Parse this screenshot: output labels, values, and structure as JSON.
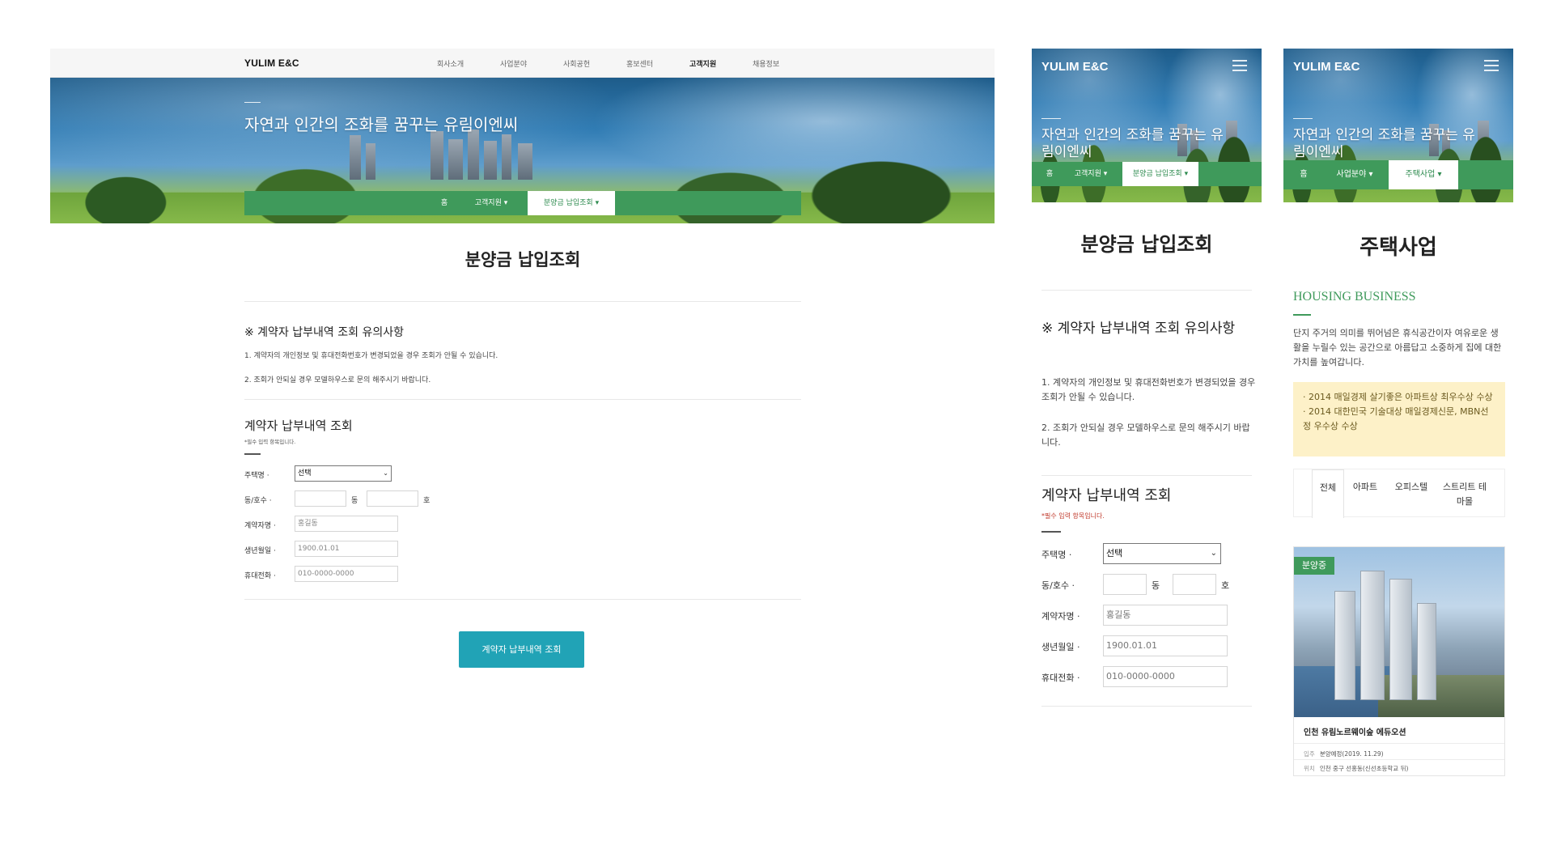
{
  "desktop": {
    "logo": "YULIM E&C",
    "menu": [
      "회사소개",
      "사업분야",
      "사회공헌",
      "홍보센터",
      "고객지원",
      "채용정보"
    ],
    "hero_title": "자연과 인간의 조화를 꿈꾸는 유림이엔씨",
    "breadcrumb": {
      "home": "홈",
      "level1": "고객지원 ▾",
      "level2": "분양금 납입조회 ▾"
    },
    "page_title": "분양금 납입조회",
    "notice": {
      "title": "※ 계약자 납부내역 조회 유의사항",
      "line1": "1. 계약자의 개인정보 및 휴대전화번호가 변경되었을 경우 조회가 안될 수 있습니다.",
      "line2": "2. 조회가 안되실 경우 모델하우스로 문의 해주시기 바랍니다."
    },
    "form": {
      "title": "계약자 납부내역 조회",
      "required_note": "*필수 입력 항목입니다.",
      "labels": {
        "housing": "주택명 ·",
        "unit": "동/호수 ·",
        "name": "계약자명 ·",
        "birth": "생년월일 ·",
        "phone": "휴대전화 ·"
      },
      "select_value": "선택",
      "dong_suffix": "동",
      "ho_suffix": "호",
      "name_placeholder": "홍길동",
      "birth_placeholder": "1900.01.01",
      "phone_placeholder": "010-0000-0000"
    },
    "submit_label": "계약자 납부내역 조회"
  },
  "mobile1": {
    "logo": "YULIM E&C",
    "hero_title": "자연과 인간의 조화를 꿈꾸는 유림이엔씨",
    "breadcrumb": {
      "home": "홈",
      "level1": "고객지원 ▾",
      "level2": "분양금 납입조회 ▾"
    },
    "page_title": "분양금 납입조회",
    "notice": {
      "title": "※ 계약자 납부내역 조회 유의사항",
      "line1": "1. 계약자의 개인정보 및 휴대전화번호가 변경되었을 경우 조회가 안될 수 있습니다.",
      "line2": "2. 조회가 안되실 경우 모델하우스로 문의 해주시기 바랍니다."
    },
    "form": {
      "title": "계약자 납부내역 조회",
      "required_note": "*필수 입력 항목입니다.",
      "labels": {
        "housing": "주택명 ·",
        "unit": "동/호수 ·",
        "name": "계약자명 ·",
        "birth": "생년월일 ·",
        "phone": "휴대전화 ·"
      },
      "select_value": "선택",
      "dong_suffix": "동",
      "ho_suffix": "호",
      "name_placeholder": "홍길동",
      "birth_placeholder": "1900.01.01",
      "phone_placeholder": "010-0000-0000"
    }
  },
  "mobile2": {
    "logo": "YULIM E&C",
    "hero_title": "자연과 인간의 조화를 꿈꾸는 유림이엔씨",
    "breadcrumb": {
      "home": "홈",
      "level1": "사업분야 ▾",
      "level2": "주택사업 ▾"
    },
    "page_title": "주택사업",
    "en_heading": "HOUSING BUSINESS",
    "description": "단지 주거의 의미를 뛰어넘은 휴식공간이자 여유로운 생활을 누릴수 있는 공간으로 아름답고 소중하게 집에 대한 가치를 높여갑니다.",
    "awards": [
      "· 2014 매일경제 살기좋은 아파트상 최우수상 수상",
      "· 2014 대한민국 기술대상 매일경제신문, MBN선정 우수상 수상"
    ],
    "tabs": [
      "전체",
      "아파트",
      "오피스텔",
      "스트리트 테마몰"
    ],
    "card": {
      "badge": "분양중",
      "title": "인천 유림노르웨이숲 에듀오션",
      "meta1_key": "입주",
      "meta1_value": "분양예정(2019. 11.29)",
      "meta2_key": "위치",
      "meta2_value": "인천 중구 선홍동(신선초등학교 뒤)"
    }
  },
  "colors": {
    "accent_green": "#3f9a5b",
    "button_teal": "#21a3b6",
    "award_bg": "#fdf1c8"
  }
}
